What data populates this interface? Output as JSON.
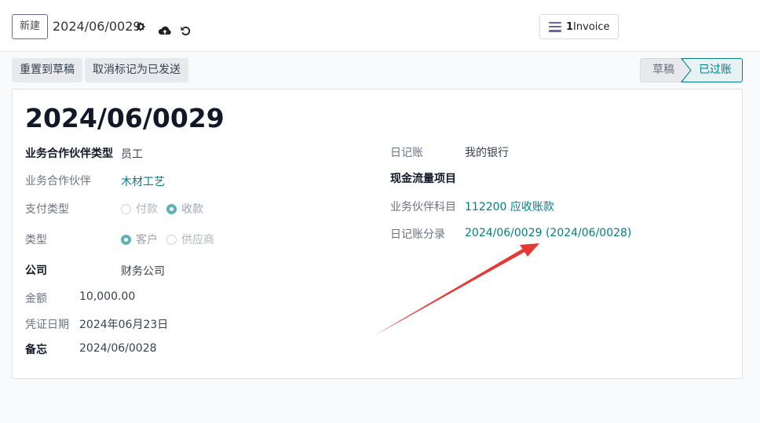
{
  "toolbar": {
    "new_label": "新建",
    "record_ref": "2024/06/0029",
    "invoice_count": "1",
    "invoice_label": "Invoice"
  },
  "actions": {
    "reset_to_draft": "重置到草稿",
    "unmark_sent": "取消标记为已发送"
  },
  "status": {
    "steps": [
      "草稿",
      "已过账"
    ],
    "current": "已过账"
  },
  "form": {
    "title": "2024/06/0029",
    "left": {
      "partner_type_label": "业务合作伙伴类型",
      "partner_type_value": "员工",
      "partner_label": "业务合作伙伴",
      "partner_value": "木材工艺",
      "payment_type_label": "支付类型",
      "payment_type_options": [
        "付款",
        "收款"
      ],
      "payment_type_selected": "收款",
      "type_label": "类型",
      "type_options": [
        "客户",
        "供应商"
      ],
      "type_selected": "客户",
      "company_label": "公司",
      "company_value": "财务公司",
      "amount_label": "金额",
      "amount_value": "10,000.00",
      "date_label": "凭证日期",
      "date_value": "2024年06月23日",
      "memo_label": "备忘",
      "memo_value": "2024/06/0028"
    },
    "right": {
      "journal_label": "日记账",
      "journal_value": "我的银行",
      "cashflow_label": "现金流量项目",
      "partner_account_label": "业务伙伴科目",
      "partner_account_value": "112200 应收账款",
      "journal_entry_label": "日记账分录",
      "journal_entry_value": "2024/06/0029 (2024/06/0028)"
    }
  },
  "colors": {
    "accent": "#017e84",
    "brand": "#71639e",
    "annotation_arrow": "#e53935"
  }
}
